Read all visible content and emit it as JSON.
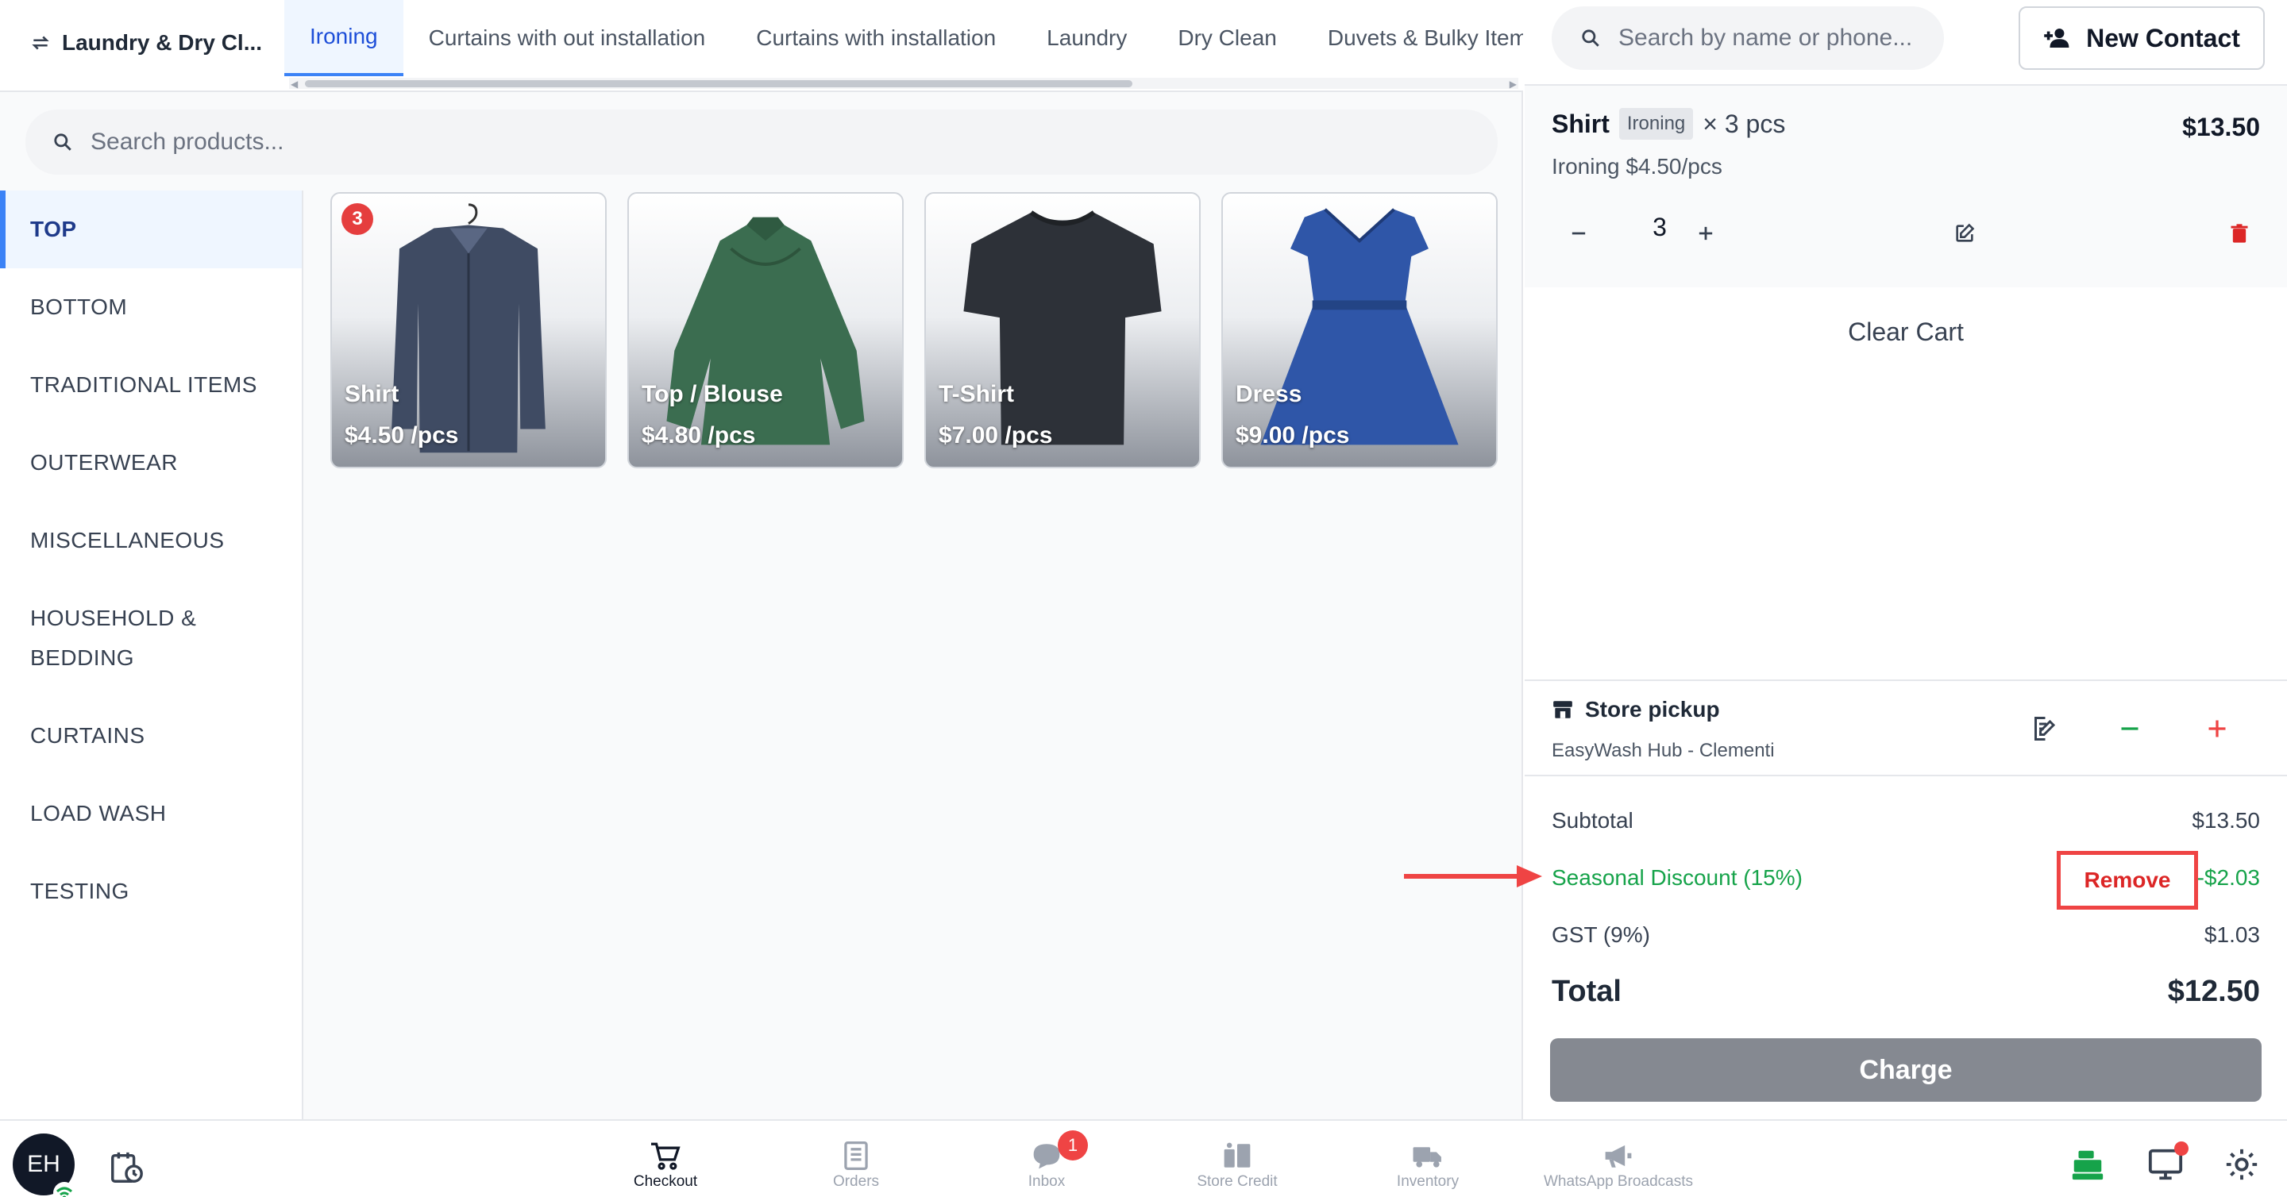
{
  "header": {
    "store_name": "Laundry & Dry Cl...",
    "tabs": [
      "Ironing",
      "Curtains with out installation",
      "Curtains with installation",
      "Laundry",
      "Dry Clean",
      "Duvets & Bulky Items"
    ]
  },
  "search": {
    "products_placeholder": "Search products..."
  },
  "categories": [
    "TOP",
    "BOTTOM",
    "TRADITIONAL ITEMS",
    "OUTERWEAR",
    "MISCELLANEOUS",
    "HOUSEHOLD & BEDDING",
    "CURTAINS",
    "LOAD WASH",
    "TESTING"
  ],
  "products": [
    {
      "name": "Shirt",
      "price": "$4.50 /pcs",
      "badge": "3",
      "icon": "shirt-image"
    },
    {
      "name": "Top / Blouse",
      "price": "$4.80 /pcs",
      "icon": "blouse-image"
    },
    {
      "name": "T-Shirt",
      "price": "$7.00 /pcs",
      "icon": "tshirt-image"
    },
    {
      "name": "Dress",
      "price": "$9.00 /pcs",
      "icon": "dress-image"
    }
  ],
  "contact": {
    "search_placeholder": "Search by name or phone...",
    "new_contact_label": "New Contact"
  },
  "cart": {
    "item": {
      "name": "Shirt",
      "service_tag": "Ironing",
      "qty_text": "× 3 pcs",
      "total": "$13.50",
      "rate": "Ironing $4.50/pcs",
      "qty": "3"
    },
    "clear_label": "Clear Cart"
  },
  "pickup": {
    "title": "Store pickup",
    "location": "EasyWash Hub - Clementi"
  },
  "summary": {
    "subtotal_label": "Subtotal",
    "subtotal": "$13.50",
    "discount_label": "Seasonal Discount (15%)",
    "discount": "-$2.03",
    "remove_label": "Remove",
    "gst_label": "GST (9%)",
    "gst": "$1.03",
    "total_label": "Total",
    "total": "$12.50",
    "charge_label": "Charge"
  },
  "user": {
    "initials": "EH"
  },
  "bottom_nav": [
    {
      "label": "Checkout",
      "icon": "cart-icon"
    },
    {
      "label": "Orders",
      "icon": "orders-icon"
    },
    {
      "label": "Inbox",
      "icon": "chat-icon",
      "badge": "1"
    },
    {
      "label": "Store Credit",
      "icon": "store-credit-icon"
    },
    {
      "label": "Inventory",
      "icon": "truck-icon"
    },
    {
      "label": "WhatsApp Broadcasts",
      "icon": "megaphone-icon"
    }
  ],
  "colors": {
    "accent": "#3b82f6",
    "danger": "#ef4444",
    "success": "#16a34a",
    "charge_button": "#858991"
  }
}
